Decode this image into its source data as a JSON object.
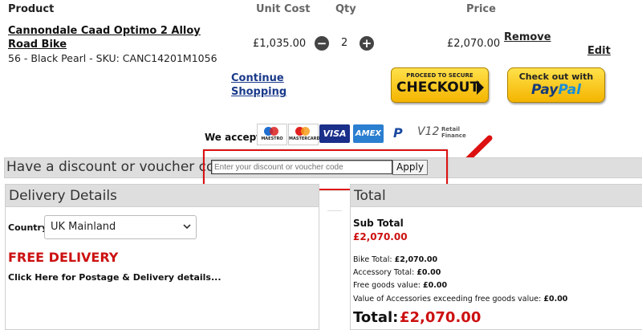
{
  "table_header": {
    "product": "Product",
    "unit_cost": "Unit Cost",
    "qty": "Qty",
    "price": "Price"
  },
  "item": {
    "name": "Cannondale Caad Optimo 2 Alloy Road Bike",
    "variant": "56 - Black Pearl - SKU: CANC14201M1056",
    "unit_cost": "£1,035.00",
    "qty": "2",
    "price": "£2,070.00",
    "remove_label": "Remove",
    "edit_label": "Edit",
    "minus_symbol": "−",
    "plus_symbol": "+"
  },
  "actions": {
    "continue_shopping": "Continue Shopping",
    "checkout_small": "PROCEED TO SECURE",
    "checkout_big": "CHECKOUT",
    "paypal_top": "Check out with",
    "paypal_pay": "Pay",
    "paypal_pal": "Pal"
  },
  "payments": {
    "we_accept": "We accept",
    "cards": [
      "MAESTRO",
      "MASTERCARD",
      "VISA",
      "AMEX",
      "P",
      "V12",
      "Retail Finance"
    ]
  },
  "discount": {
    "label": "Have a discount or voucher code?",
    "placeholder": "Enter your discount or voucher code",
    "apply": "Apply"
  },
  "delivery": {
    "title": "Delivery Details",
    "country_label": "Country",
    "country_value": "UK Mainland",
    "free_delivery": "FREE DELIVERY",
    "postage_link": "Click Here for Postage & Delivery details..."
  },
  "totals": {
    "title": "Total",
    "subtotal_label": "Sub Total",
    "subtotal_value": "£2,070.00",
    "bike_total_label": "Bike Total:",
    "bike_total_value": "£2,070.00",
    "accessory_label": "Accessory Total:",
    "accessory_value": "£0.00",
    "free_goods_label": "Free goods value:",
    "free_goods_value": "£0.00",
    "exceeding_label": "Value of Accessories exceeding free goods value:",
    "exceeding_value": "£0.00",
    "total_label": "Total:",
    "total_value": "£2,070.00"
  },
  "colors": {
    "accent_red": "#cc1111",
    "link_blue": "#1a3a8a",
    "checkout_yellow": "#f4b400",
    "highlight_red": "#dd1111"
  }
}
